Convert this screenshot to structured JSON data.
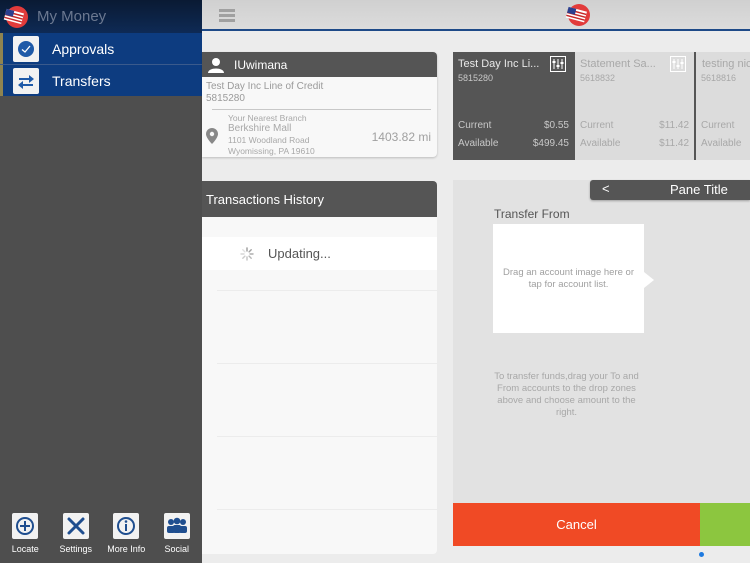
{
  "sidebar": {
    "title": "My Money",
    "items": [
      {
        "label": "Approvals",
        "icon": "checkmark-circle-icon"
      },
      {
        "label": "Transfers",
        "icon": "swap-arrows-icon"
      }
    ],
    "footer": [
      {
        "label": "Locate",
        "icon": "crosshair-icon"
      },
      {
        "label": "Settings",
        "icon": "tools-icon"
      },
      {
        "label": "More Info",
        "icon": "info-icon"
      },
      {
        "label": "Social",
        "icon": "group-icon"
      }
    ]
  },
  "profile": {
    "username": "IUwimana",
    "account_name": "Test Day Inc Line of Credit",
    "account_number": "5815280",
    "branch": {
      "heading": "Your Nearest Branch",
      "name": "Berkshire Mall",
      "street": "1101 Woodland Road",
      "city": "Wyomissing, PA 19610",
      "distance": "1403.82 mi"
    }
  },
  "transactions": {
    "title": "Transactions History",
    "status": "Updating..."
  },
  "accounts": [
    {
      "name": "Test Day Inc Li...",
      "number": "5815280",
      "current_label": "Current",
      "current": "$0.55",
      "available_label": "Available",
      "available": "$499.45"
    },
    {
      "name": "Statement Sa...",
      "number": "5618832",
      "current_label": "Current",
      "current": "$11.42",
      "available_label": "Available",
      "available": "$11.42"
    },
    {
      "name": "testing nic",
      "number": "5618816",
      "current_label": "Current",
      "current": "",
      "available_label": "Available",
      "available": ""
    }
  ],
  "pane": {
    "back": "<",
    "title": "Pane Title",
    "transfer_from_label": "Transfer From",
    "drop_hint": "Drag an account image here or tap for account list.",
    "help": "To transfer funds,drag your To and From accounts to the drop zones above and choose amount to the right.",
    "cancel": "Cancel"
  },
  "colors": {
    "nav_blue": "#0d3c80",
    "cancel_red": "#f04a25",
    "confirm_green": "#8cc63f",
    "dark_header": "#555555"
  }
}
